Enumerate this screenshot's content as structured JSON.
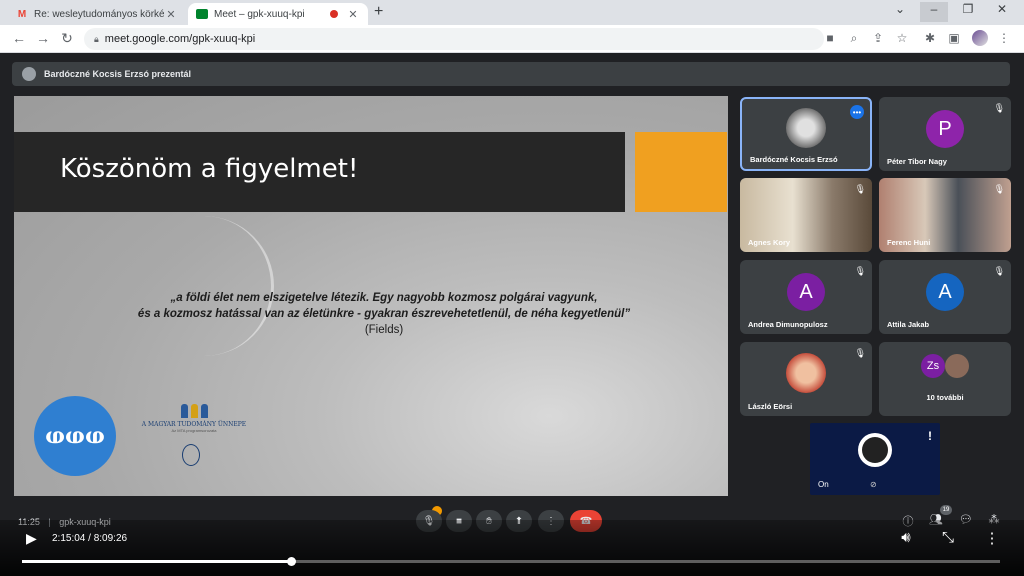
{
  "browser": {
    "tabs": [
      {
        "title": "Re: wesleytudományos körkép e...",
        "icon": "gmail-icon",
        "active": false
      },
      {
        "title": "Meet – gpk-xuuq-kpi",
        "icon": "meet-icon",
        "active": true
      }
    ],
    "url": "meet.google.com/gpk-xuuq-kpi"
  },
  "meet": {
    "presenter_text": "Bardóczné Kocsis Erzsó prezentál",
    "slide": {
      "title": "Köszönöm a figyelmet!",
      "quote_line1": "„a földi élet nem elszigetelve létezik. Egy nagyobb kozmosz polgárai vagyunk,",
      "quote_line2": "és a kozmosz hatással van az életünkre - gyakran észrevehetetlenül, de néha kegyetlenül”",
      "quote_source": "(Fields)",
      "logo_text": "A MAGYAR TUDOMÁNY ÜNNEPE",
      "logo_sub": "Az MTA programsorozata"
    },
    "participants": [
      {
        "name": "Bardóczné Kocsis Erzsó"
      },
      {
        "name": "Péter Tibor Nagy",
        "letter": "P",
        "color": "#8e24aa"
      },
      {
        "name": "Agnes Kory"
      },
      {
        "name": "Ferenc Huni"
      },
      {
        "name": "Andrea Dimunopulosz",
        "letter": "A",
        "color": "#7b1fa2"
      },
      {
        "name": "Attila Jakab",
        "letter": "A",
        "color": "#1565c0"
      },
      {
        "name": "László Eörsi"
      },
      {
        "name": "10 további",
        "letter": "Zs",
        "color": "#7b1fa2"
      }
    ],
    "obs": {
      "label": "On",
      "alert": "!"
    },
    "meeting_time": "11:25",
    "meeting_code": "gpk-xuuq-kpi",
    "people_count": "19"
  },
  "player": {
    "time": "2:15:04 / 8:09:26",
    "progress": 0.275
  }
}
